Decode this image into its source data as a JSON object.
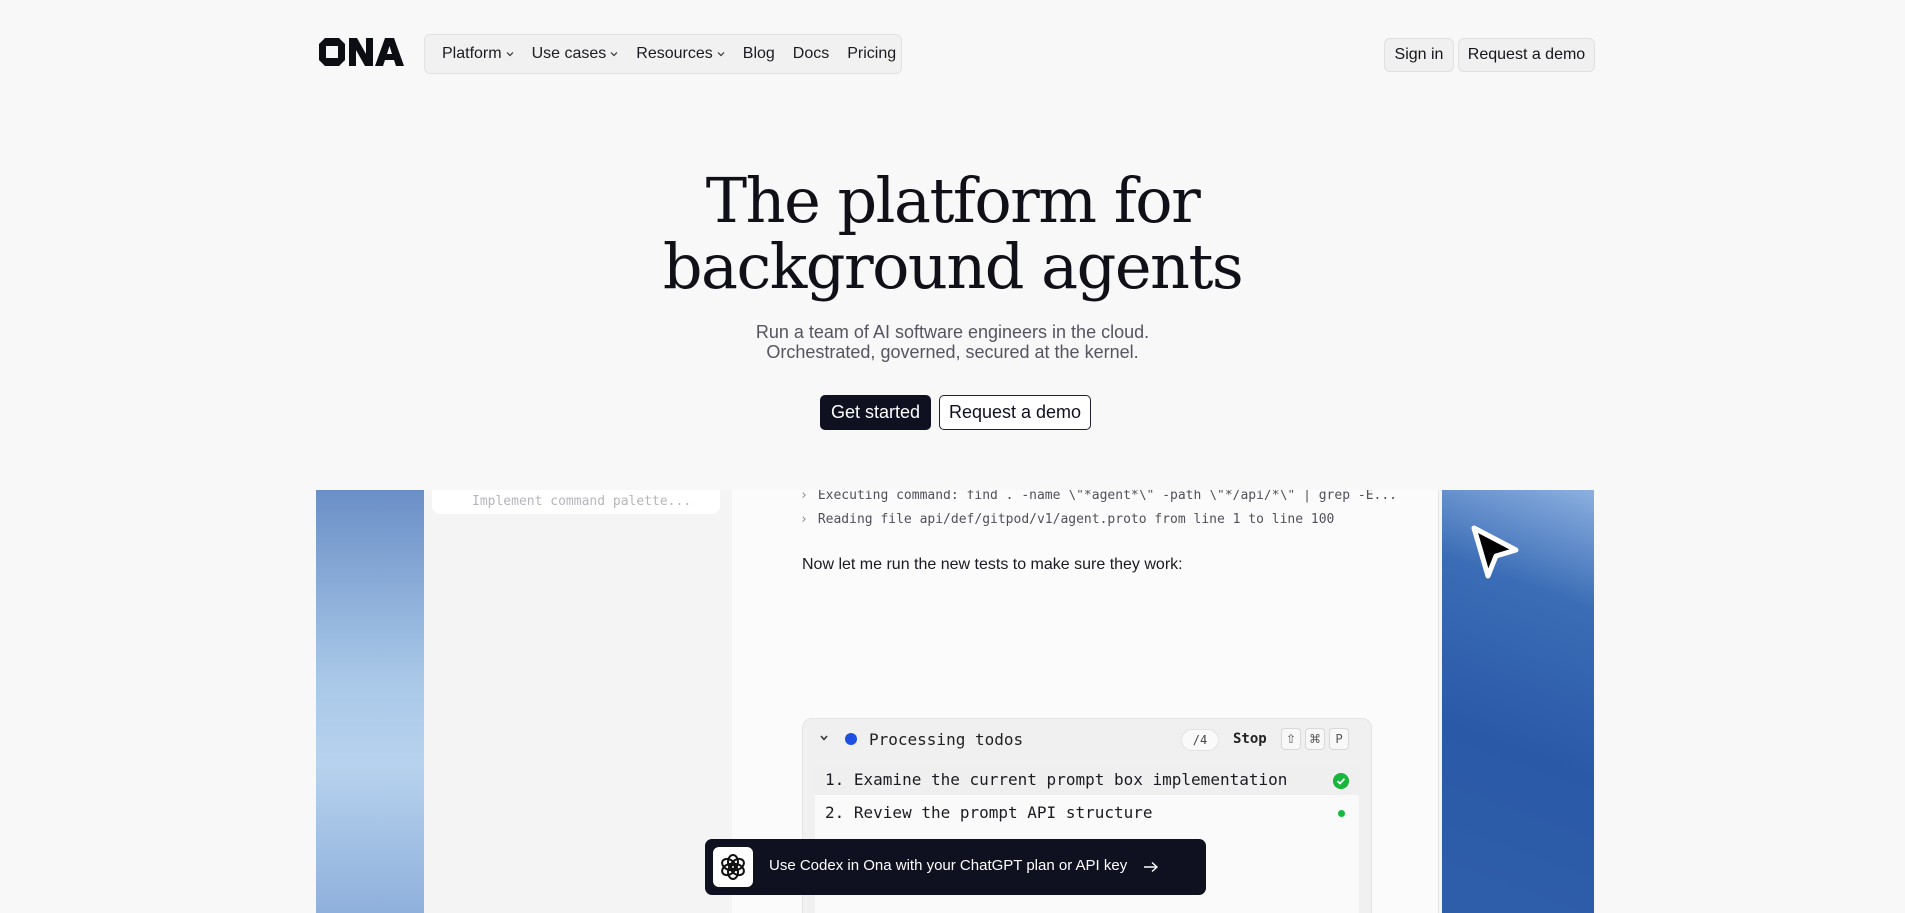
{
  "brand": {
    "logo_text": "ONA"
  },
  "nav": {
    "items": [
      {
        "label": "Platform",
        "has_menu": true
      },
      {
        "label": "Use cases",
        "has_menu": true
      },
      {
        "label": "Resources",
        "has_menu": true
      },
      {
        "label": "Blog",
        "has_menu": false
      },
      {
        "label": "Docs",
        "has_menu": false
      },
      {
        "label": "Pricing",
        "has_menu": false
      }
    ],
    "sign_in": "Sign in",
    "request_demo": "Request a demo"
  },
  "hero": {
    "title_line1": "The platform for",
    "title_line2": "background agents",
    "subtitle_line1": "Run a team of AI software engineers in the cloud.",
    "subtitle_line2": "Orchestrated, governed, secured at the kernel.",
    "cta_primary": "Get started",
    "cta_secondary": "Request a demo"
  },
  "showcase": {
    "sidebar_card_text": "Implement command palette...",
    "log_lines": [
      "Executing command: find . -name \\\"*agent*\\\" -path \\\"*/api/*\\\" | grep -E...",
      "Reading file api/def/gitpod/v1/agent.proto from line 1 to line 100"
    ],
    "message": "Now let me run the new tests to make sure they work:",
    "todo": {
      "title": "Processing todos",
      "count": "/4",
      "stop_label": "Stop",
      "keys": [
        "⇧",
        "⌘",
        "P"
      ],
      "items": [
        {
          "text": "1. Examine the current prompt box implementation",
          "status": "done"
        },
        {
          "text": "2. Review the prompt API structure",
          "status": "in-progress"
        }
      ]
    }
  },
  "banner": {
    "text": "Use Codex in Ona with your ChatGPT plan or API key"
  },
  "colors": {
    "background": "#f8f8f8",
    "primary": "#0f1020",
    "accent_blue": "#1e4fe0",
    "success_green": "#18b63c"
  }
}
